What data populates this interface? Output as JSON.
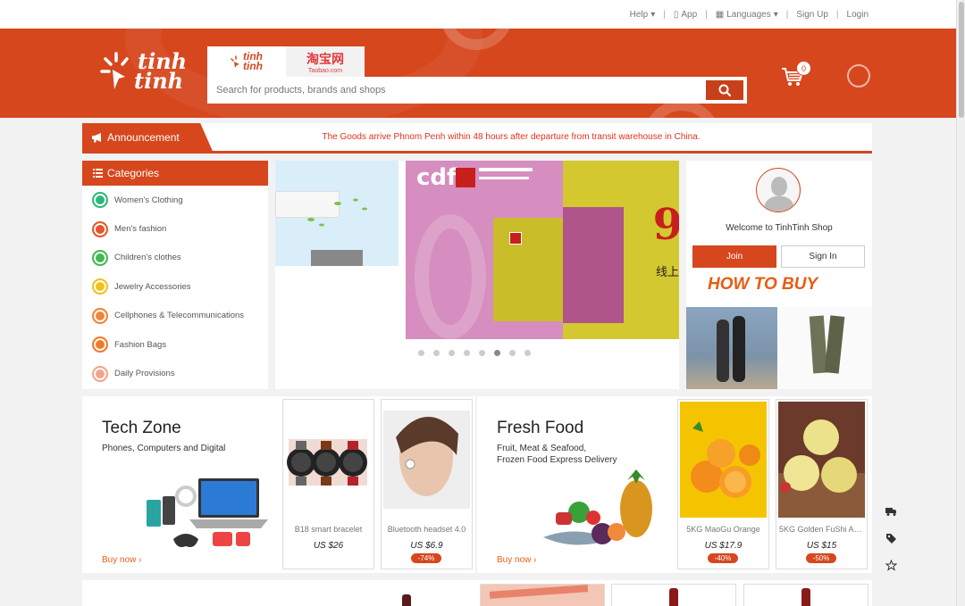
{
  "topbar": {
    "help": "Help",
    "app": "App",
    "languages": "Languages",
    "signup": "Sign Up",
    "login": "Login"
  },
  "header": {
    "logo_line1": "tinh",
    "logo_line2": "tinh",
    "tab_tinhtinh_1": "tinh",
    "tab_tinhtinh_2": "tinh",
    "tab_taobao": "淘宝网",
    "tab_taobao_sub": "Taobao.com",
    "search_placeholder": "Search for products, brands and shops",
    "cart_count": "0"
  },
  "announcement": {
    "label": "Announcement",
    "message": "The Goods arrive Phnom Penh within 48 hours after departure from transit warehouse in China."
  },
  "categories": {
    "title": "Categories",
    "items": [
      {
        "label": "Women's Clothing",
        "color": "#2db87a"
      },
      {
        "label": "Men's fashion",
        "color": "#e8552a"
      },
      {
        "label": "Children's clothes",
        "color": "#43b94f"
      },
      {
        "label": "Jewelry Accessories",
        "color": "#f0c21a"
      },
      {
        "label": "Cellphones & Telecommunications",
        "color": "#f0843a"
      },
      {
        "label": "Fashion Bags",
        "color": "#f07a2a"
      },
      {
        "label": "Daily Provisions",
        "color": "#f3a48c"
      }
    ]
  },
  "banner": {
    "cdf_text": "cdf",
    "nine": "9",
    "cn_text": "线上",
    "active_dot": 5,
    "dot_count": 8
  },
  "userpanel": {
    "welcome": "Welcome to TinhTinh Shop",
    "join": "Join",
    "signin": "Sign In",
    "howto": "HOW TO BUY"
  },
  "tech_zone": {
    "title": "Tech Zone",
    "desc": "Phones, Computers and Digital",
    "buynow": "Buy now",
    "products": [
      {
        "name": "B18 smart bracelet",
        "price": "US $26",
        "discount": ""
      },
      {
        "name": "Bluetooth headset 4.0",
        "price": "US $6.9",
        "discount": "-74%"
      }
    ]
  },
  "fresh_food": {
    "title": "Fresh Food",
    "desc_line1": "Fruit, Meat & Seafood,",
    "desc_line2": "Frozen Food Express Delivery",
    "buynow": "Buy now",
    "products": [
      {
        "name": "5KG MaoGu Orange",
        "price": "US $17.9",
        "discount": "-40%"
      },
      {
        "name": "5KG Golden FuShi Ap...",
        "price": "US $15",
        "discount": "-50%"
      }
    ]
  },
  "colors": {
    "brand": "#d6471e",
    "announcement_text": "#e4321c",
    "buynow": "#e8601c"
  }
}
